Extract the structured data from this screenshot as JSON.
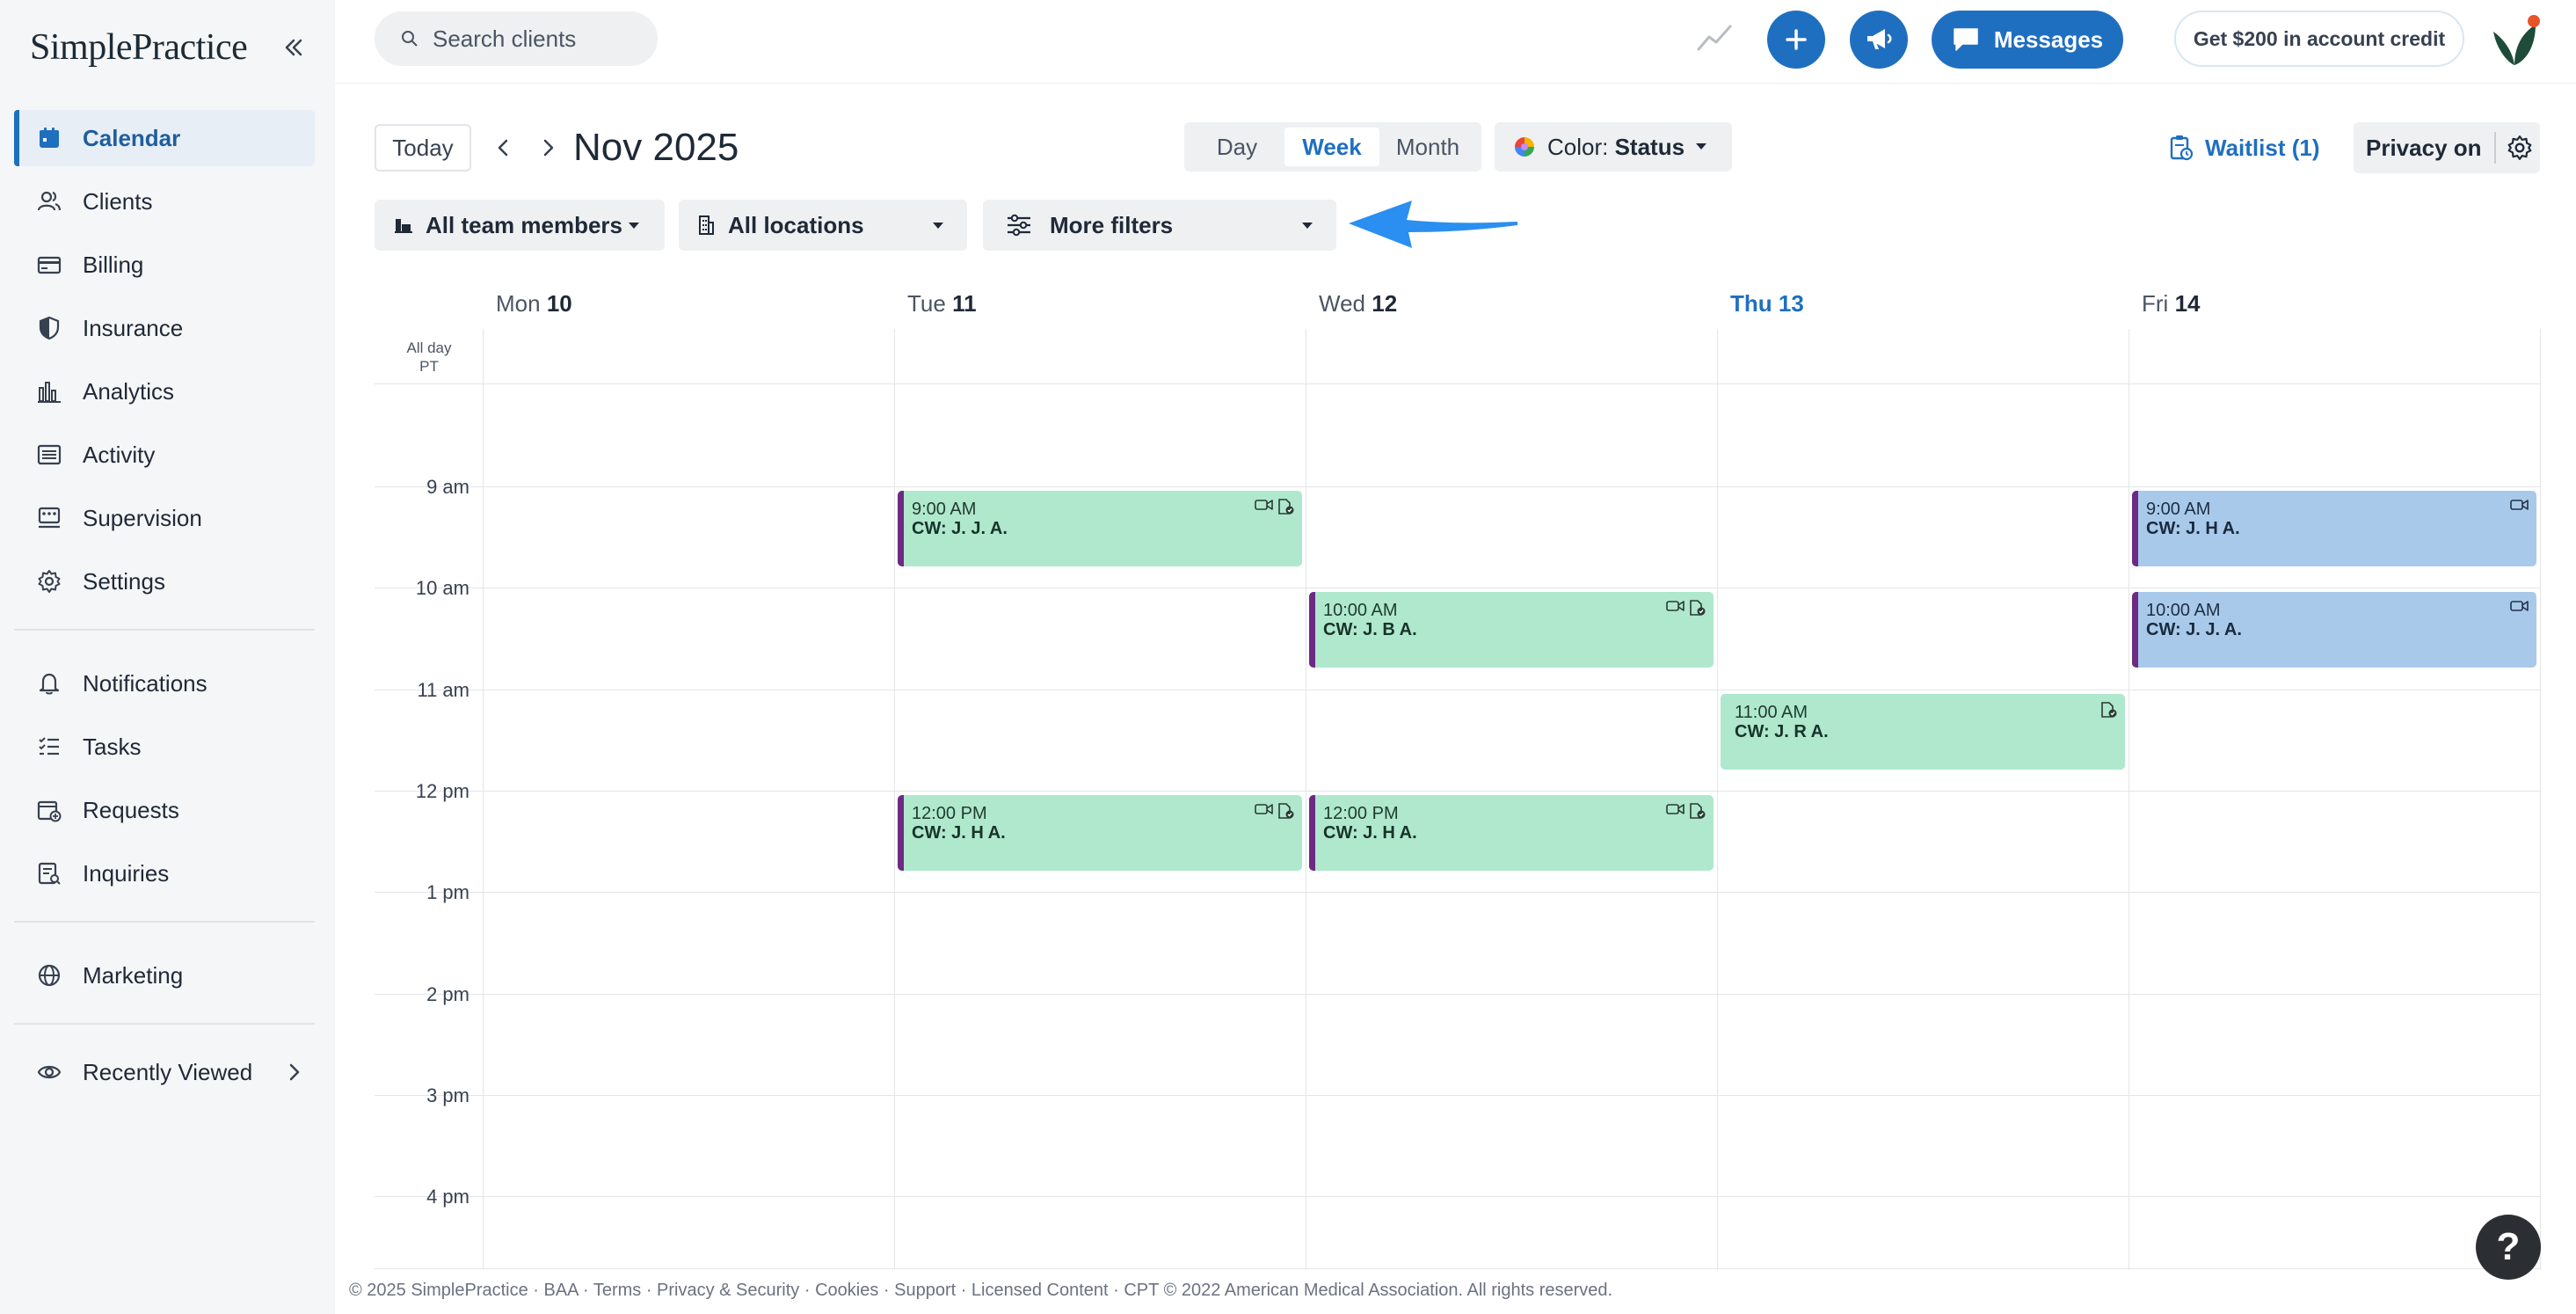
{
  "brand": {
    "logo_text": "SimplePractice"
  },
  "sidebar": {
    "items": [
      {
        "label": "Calendar",
        "icon": "calendar-icon",
        "active": true
      },
      {
        "label": "Clients",
        "icon": "clients-icon"
      },
      {
        "label": "Billing",
        "icon": "billing-icon"
      },
      {
        "label": "Insurance",
        "icon": "shield-icon"
      },
      {
        "label": "Analytics",
        "icon": "bar-chart-icon"
      },
      {
        "label": "Activity",
        "icon": "activity-icon"
      },
      {
        "label": "Supervision",
        "icon": "supervision-icon"
      },
      {
        "label": "Settings",
        "icon": "gear-icon"
      },
      {
        "label": "Notifications",
        "icon": "bell-icon"
      },
      {
        "label": "Tasks",
        "icon": "tasks-icon"
      },
      {
        "label": "Requests",
        "icon": "requests-icon"
      },
      {
        "label": "Inquiries",
        "icon": "inquiries-icon"
      },
      {
        "label": "Marketing",
        "icon": "globe-icon"
      },
      {
        "label": "Recently Viewed",
        "icon": "eye-icon"
      }
    ]
  },
  "topbar": {
    "search_placeholder": "Search clients",
    "messages_label": "Messages",
    "credit_label": "Get $200 in account credit"
  },
  "toolbar": {
    "today_label": "Today",
    "month_title": "Nov 2025",
    "views": [
      "Day",
      "Week",
      "Month"
    ],
    "active_view": "Week",
    "color_label": "Color:",
    "color_value": "Status",
    "waitlist_label": "Waitlist (1)",
    "privacy_label": "Privacy on"
  },
  "filters": {
    "team_members": "All team members",
    "locations": "All locations",
    "more_filters": "More filters"
  },
  "calendar": {
    "days": [
      {
        "dow": "Mon",
        "num": "10"
      },
      {
        "dow": "Tue",
        "num": "11"
      },
      {
        "dow": "Wed",
        "num": "12"
      },
      {
        "dow": "Thu",
        "num": "13",
        "today": true
      },
      {
        "dow": "Fri",
        "num": "14"
      }
    ],
    "all_day_label": "All day",
    "timezone": "PT",
    "hours": [
      "9 am",
      "10 am",
      "11 am",
      "12 pm",
      "1 pm",
      "2 pm",
      "3 pm",
      "4 pm"
    ],
    "events": [
      {
        "day": 1,
        "start": "9:00 AM",
        "client": "CW: J. J. A.",
        "color": "green",
        "video": true,
        "portal": true
      },
      {
        "day": 2,
        "start": "10:00 AM",
        "client": "CW: J. B A.",
        "color": "green",
        "video": true,
        "portal": true
      },
      {
        "day": 3,
        "start": "11:00 AM",
        "client": "CW: J. R A.",
        "color": "green",
        "video": false,
        "portal": true
      },
      {
        "day": 1,
        "start": "12:00 PM",
        "client": "CW: J. H A.",
        "color": "green",
        "video": true,
        "portal": true
      },
      {
        "day": 2,
        "start": "12:00 PM",
        "client": "CW: J. H A.",
        "color": "green",
        "video": true,
        "portal": true
      },
      {
        "day": 4,
        "start": "9:00 AM",
        "client": "CW: J. H A.",
        "color": "blue",
        "video": true,
        "portal": false
      },
      {
        "day": 4,
        "start": "10:00 AM",
        "client": "CW: J. J. A.",
        "color": "blue",
        "video": true,
        "portal": false
      }
    ]
  },
  "footer": {
    "text": "© 2025 SimplePractice · BAA · Terms · Privacy & Security · Cookies · Support · Licensed Content · CPT © 2022 American Medical Association. All rights reserved."
  },
  "help": {
    "label": "?"
  },
  "colors": {
    "accent": "#1f6fc1",
    "event_green": "#afe8cd",
    "event_blue": "#a9c9ea",
    "event_bar": "#6d2a84",
    "callout_arrow": "#2a8ff0"
  }
}
